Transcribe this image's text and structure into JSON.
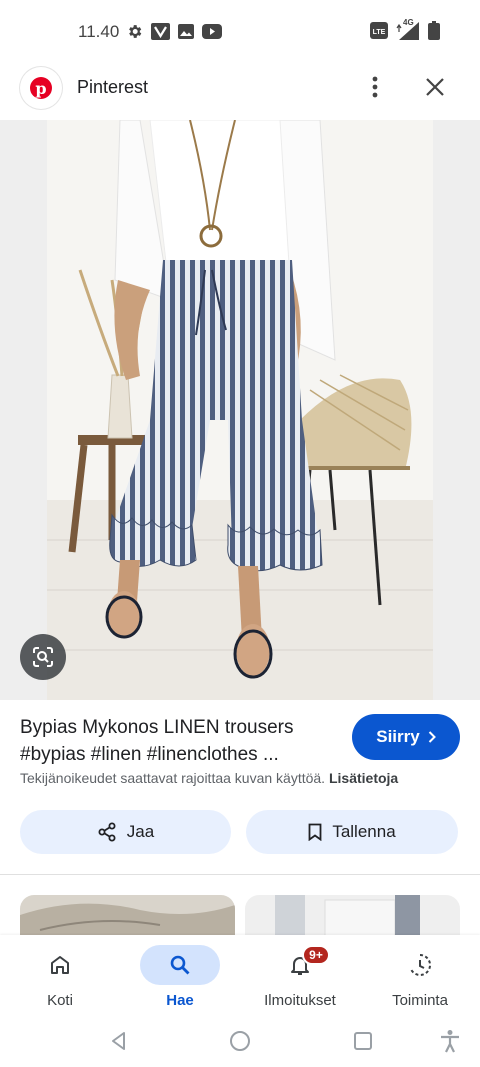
{
  "status_bar": {
    "time": "11.40",
    "left_icons": [
      "gear-icon",
      "v-app-icon",
      "gallery-icon",
      "youtube-icon"
    ],
    "right_icons": [
      "volte-icon",
      "4g-signal-icon",
      "battery-icon"
    ],
    "network_label": "4G"
  },
  "header": {
    "app_icon": "pinterest-logo",
    "app_icon_letter": "p",
    "title": "Pinterest"
  },
  "pin": {
    "title": "Bypias Mykonos LINEN trousers #bypias #linen #linenclothes ...",
    "visit_label": "Siirry",
    "copyright_text": "Tekijänoikeudet saattavat rajoittaa kuvan käyttöä.",
    "learn_more": "Lisätietoja",
    "share_label": "Jaa",
    "save_label": "Tallenna"
  },
  "bottom_nav": {
    "items": [
      {
        "label": "Koti",
        "icon": "home-icon"
      },
      {
        "label": "Hae",
        "icon": "search-icon",
        "active": true
      },
      {
        "label": "Ilmoitukset",
        "icon": "bell-icon",
        "badge": "9+"
      },
      {
        "label": "Toiminta",
        "icon": "activity-icon"
      }
    ]
  },
  "colors": {
    "accent": "#0b57d0",
    "active_pill": "#d3e3fd",
    "action_bg": "#e8f0fe",
    "badge": "#b3261e",
    "pinterest_red": "#e60023"
  }
}
